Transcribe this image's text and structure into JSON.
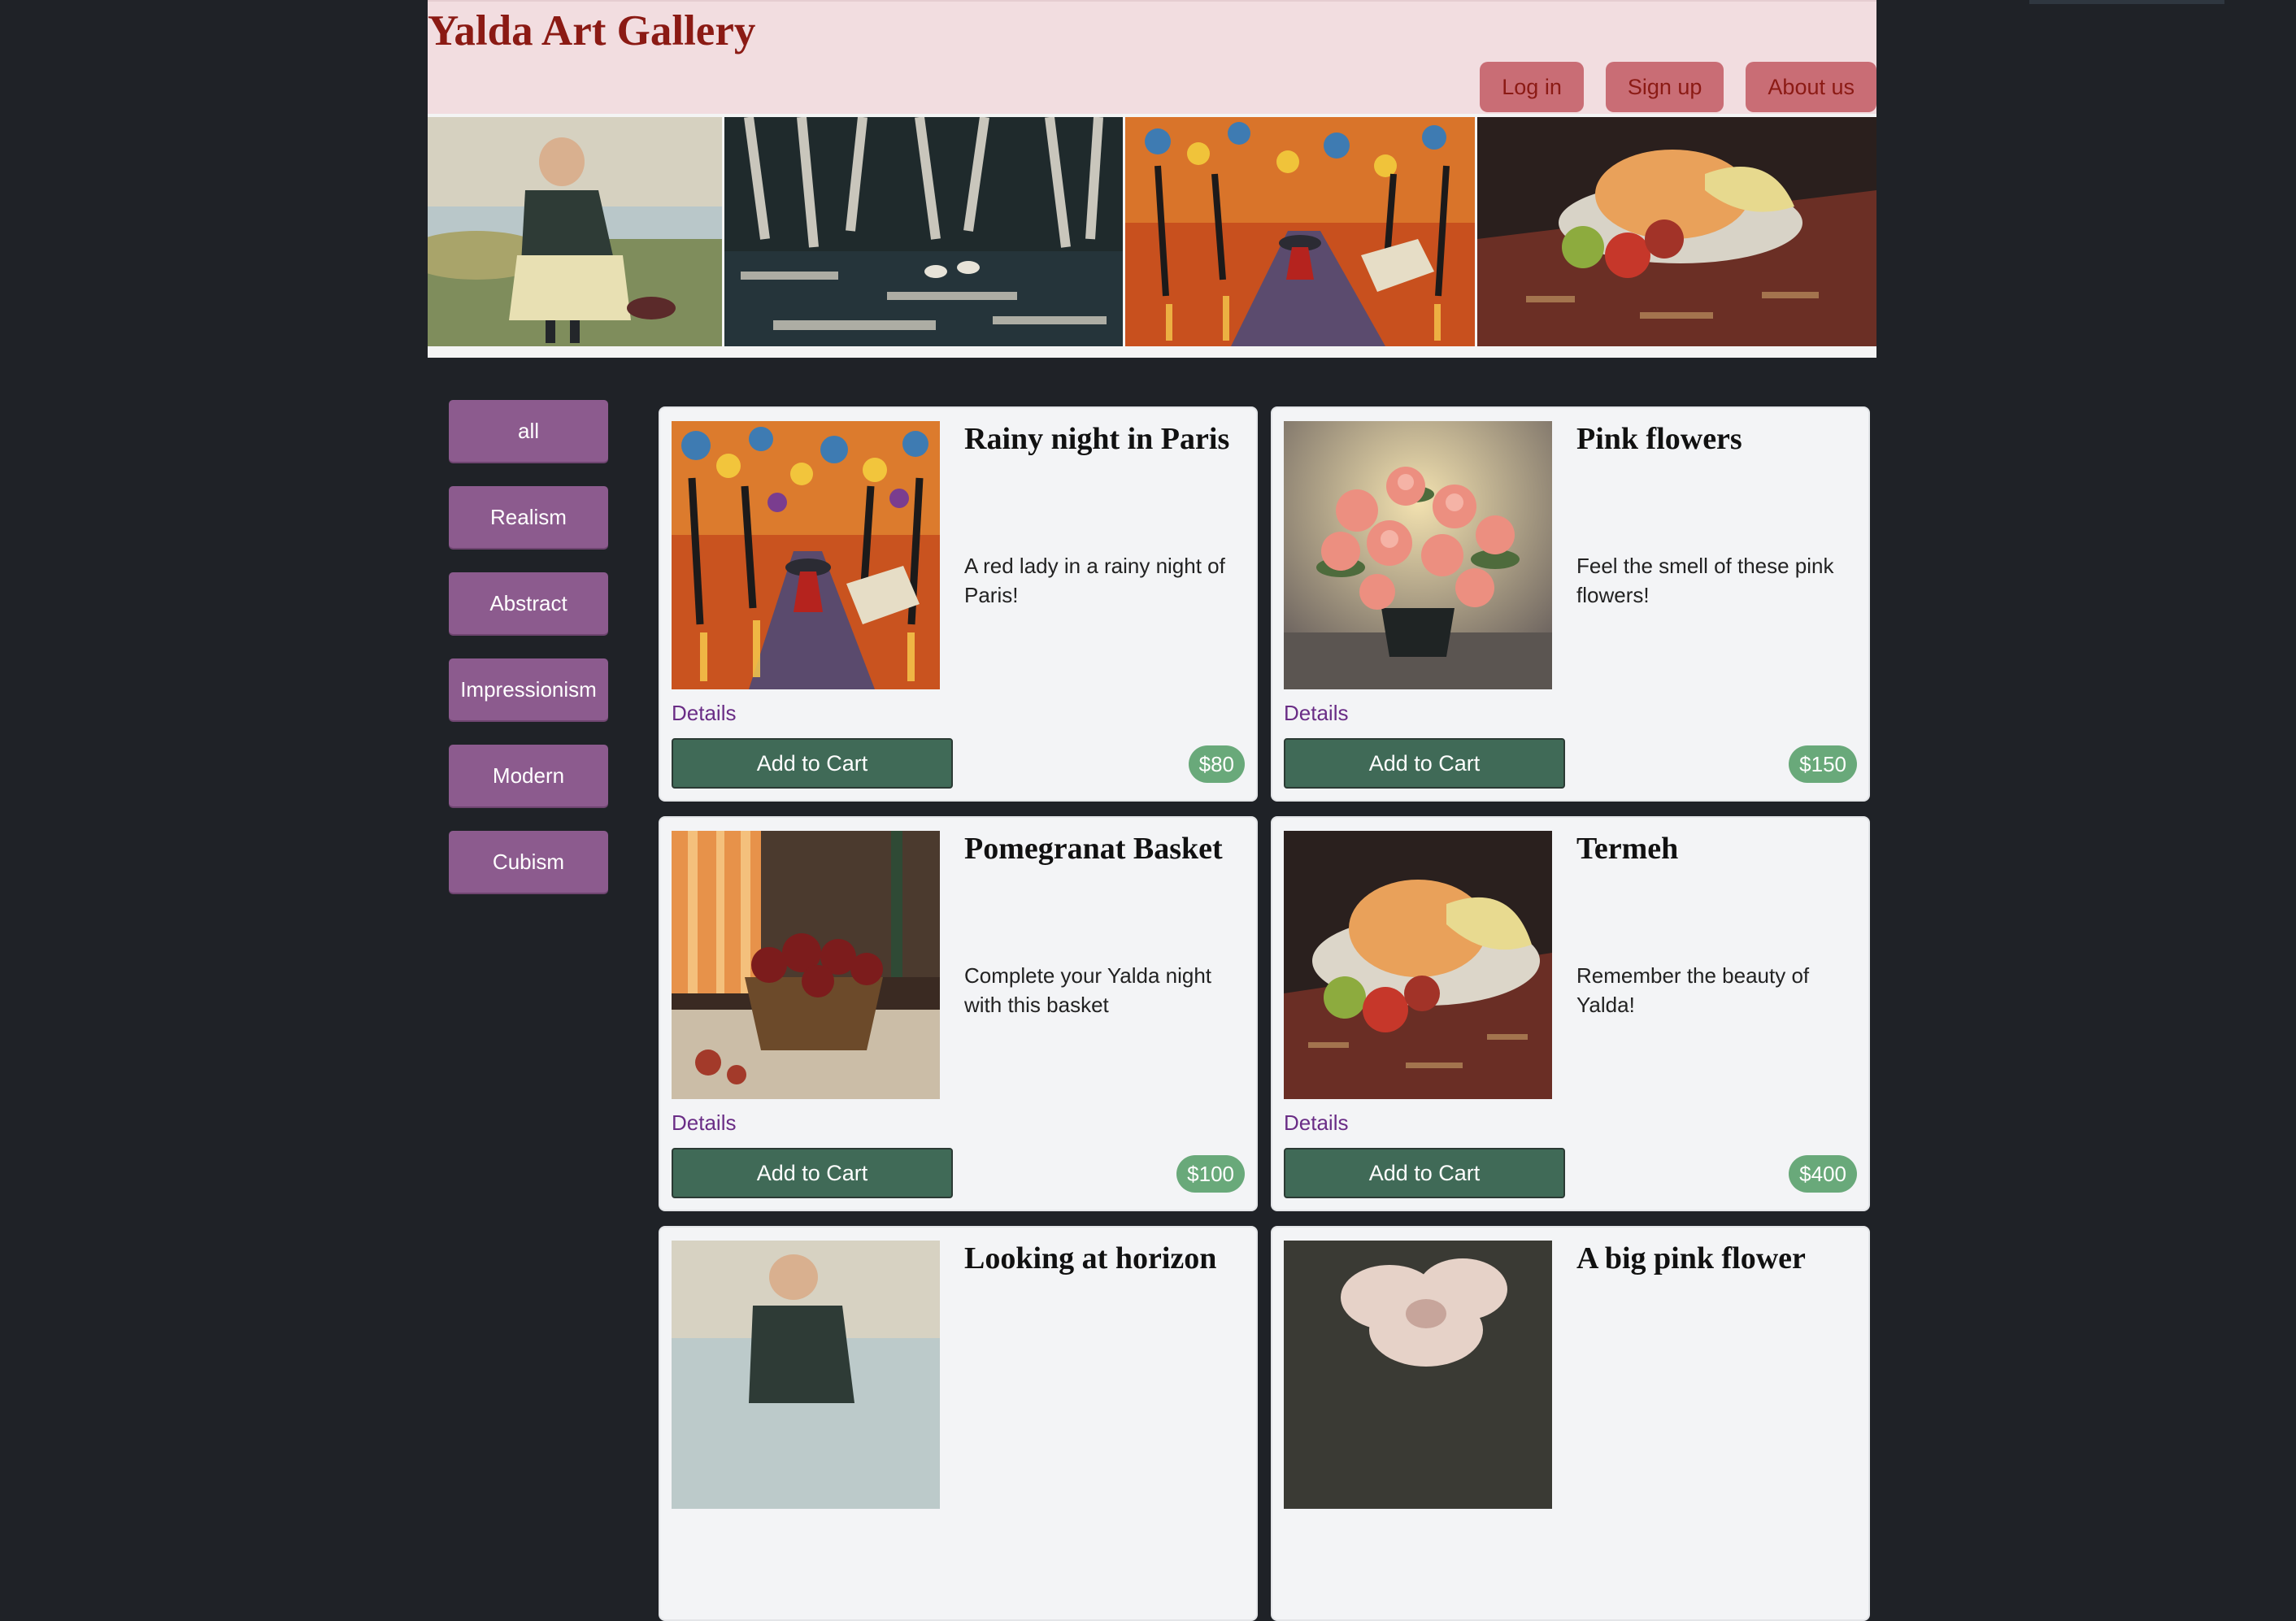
{
  "header": {
    "title": "Yalda Art Gallery",
    "nav": [
      {
        "label": "Log in",
        "name": "login-button"
      },
      {
        "label": "Sign up",
        "name": "signup-button"
      },
      {
        "label": "About us",
        "name": "about-us-button"
      }
    ]
  },
  "banner": {
    "images": [
      "woman-painting-image",
      "birch-swans-painting-image",
      "rainy-street-painting-image",
      "melon-still-life-painting-image"
    ]
  },
  "sidebar": {
    "categories": [
      "all",
      "Realism",
      "Abstract",
      "Impressionism",
      "Modern",
      "Cubism"
    ]
  },
  "products": [
    {
      "title": "Rainy night in Paris",
      "description": "A red lady in a rainy night of Paris!",
      "details": "Details",
      "cart": "Add to Cart",
      "price": "$80",
      "image": "rainy-street-painting-image"
    },
    {
      "title": "Pink flowers",
      "description": "Feel the smell of these pink flowers!",
      "details": "Details",
      "cart": "Add to Cart",
      "price": "$150",
      "image": "pink-roses-painting-image"
    },
    {
      "title": "Pomegranat Basket",
      "description": "Complete your Yalda night with this basket",
      "details": "Details",
      "cart": "Add to Cart",
      "price": "$100",
      "image": "pomegranate-basket-painting-image"
    },
    {
      "title": "Termeh",
      "description": "Remember the beauty of Yalda!",
      "details": "Details",
      "cart": "Add to Cart",
      "price": "$400",
      "image": "melon-still-life-painting-image"
    },
    {
      "title": "Looking at horizon",
      "image": "woman-painting-image"
    },
    {
      "title": "A big pink flower",
      "image": "big-pink-flower-painting-image"
    }
  ]
}
